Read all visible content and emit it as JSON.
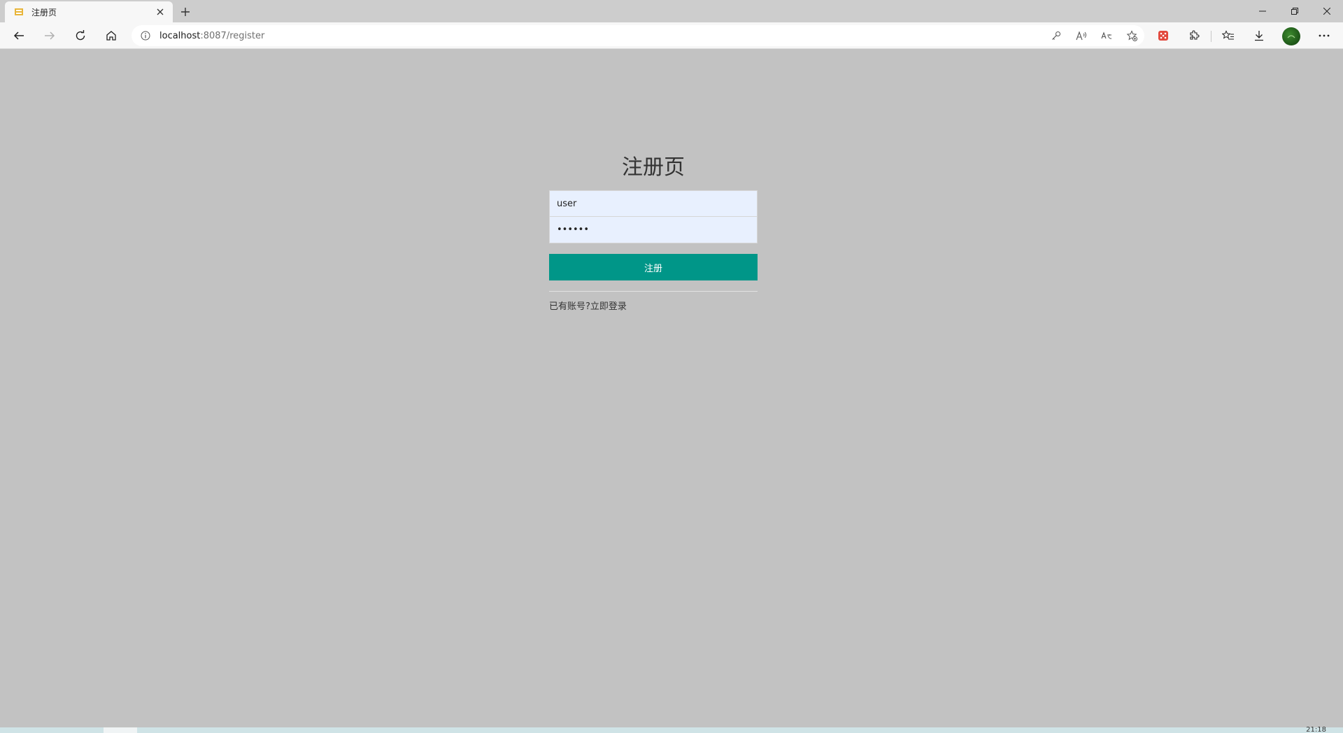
{
  "browser": {
    "tab": {
      "title": "注册页"
    },
    "address": {
      "host": "localhost",
      "path": ":8087/register"
    }
  },
  "page": {
    "title": "注册页",
    "username": {
      "value": "user"
    },
    "password": {
      "value": "••••••"
    },
    "submit_label": "注册",
    "footer": {
      "prompt": "已有账号?",
      "login_link": "立即登录"
    }
  },
  "taskbar": {
    "clock": "21:18"
  },
  "colors": {
    "accent": "#009688",
    "page_bg": "#c2c2c2",
    "input_bg": "#e8f0fe"
  }
}
